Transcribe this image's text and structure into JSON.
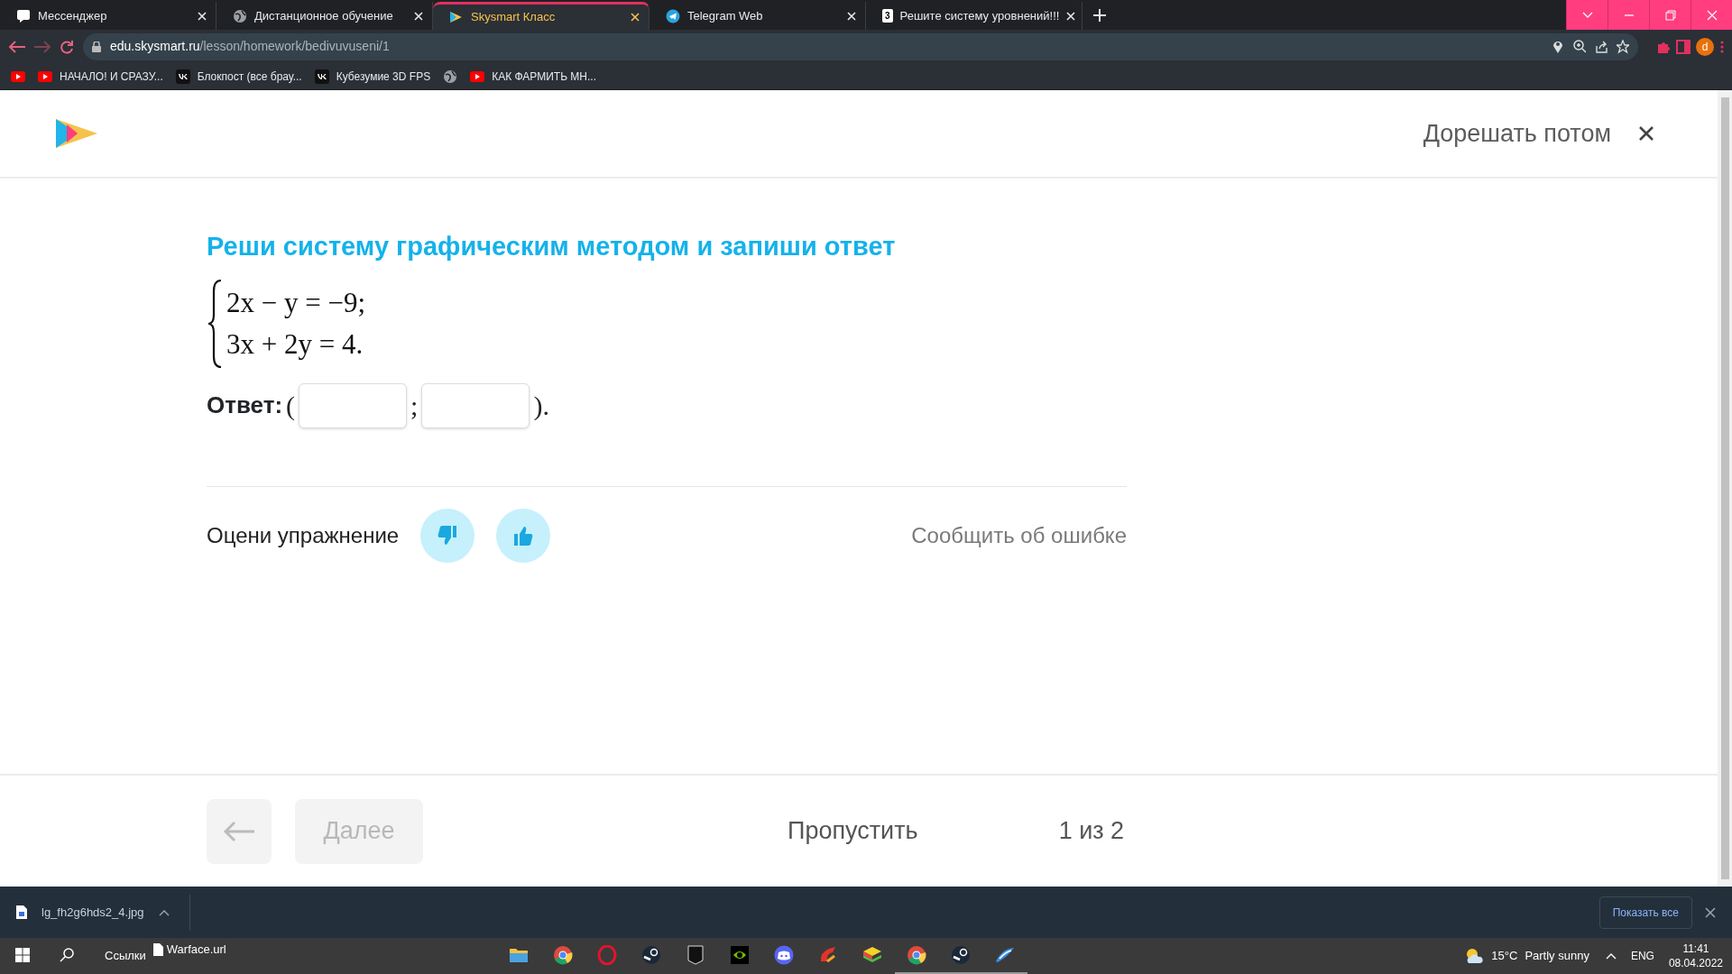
{
  "browser": {
    "tabs": [
      {
        "title": "Мессенджер",
        "kind": "chat",
        "selected": false
      },
      {
        "title": "Дистанционное обучение",
        "kind": "globe",
        "selected": false
      },
      {
        "title": "Skysmart Класс",
        "kind": "skysmart",
        "selected": true
      },
      {
        "title": "Telegram Web",
        "kind": "telegram",
        "selected": false
      },
      {
        "title": "Решите систему уровнений!!!",
        "kind": "badge",
        "badge": "3",
        "selected": false
      }
    ],
    "address": {
      "host": "edu.skysmart.ru",
      "path": "/lesson/homework/bedivuvuseni/1"
    },
    "avatar": "d",
    "bookmarks": [
      {
        "kind": "youtube"
      },
      {
        "kind": "youtube",
        "label": "НАЧАЛО! И СРАЗУ..."
      },
      {
        "kind": "vk",
        "label": "Блокпост (все брау..."
      },
      {
        "kind": "vk",
        "label": "Кубезумие 3D FPS"
      },
      {
        "kind": "globe"
      },
      {
        "kind": "youtube",
        "label": "КАК ФАРМИТЬ МН..."
      }
    ]
  },
  "page": {
    "finish_later": "Дорешать потом",
    "title": "Реши систему графическим методом и запиши ответ",
    "equations": [
      "2x − y = −9;",
      "3x + 2y = 4."
    ],
    "answer": {
      "label": "Ответ:",
      "open": "(",
      "separator": ";",
      "close": ")."
    },
    "rating_label": "Оцени упражнение",
    "report": "Сообщить об ошибке",
    "footer": {
      "next": "Далее",
      "next_disabled": true,
      "skip": "Пропустить",
      "progress": "1 из 2"
    }
  },
  "downloads": {
    "file": "lg_fh2g6hds2_4.jpg",
    "show_all": "Показать все"
  },
  "taskbar": {
    "links": "Ссылки",
    "shortcut": "Warface.url",
    "apps": [
      {
        "kind": "folder",
        "running": false
      },
      {
        "kind": "chrome",
        "running": false
      },
      {
        "kind": "opera",
        "running": false
      },
      {
        "kind": "steam",
        "running": false
      },
      {
        "kind": "epic",
        "running": false
      },
      {
        "kind": "nvidia",
        "running": false
      },
      {
        "kind": "discord",
        "running": false
      },
      {
        "kind": "ccleaner",
        "running": false
      },
      {
        "kind": "bluestacks",
        "running": false
      },
      {
        "kind": "chrome",
        "running": true
      },
      {
        "kind": "steam",
        "running": true
      },
      {
        "kind": "warface",
        "running": true
      }
    ],
    "temperature": "15°C",
    "weather": "Partly sunny",
    "language": "ENG",
    "time": "11:41",
    "date": "08.04.2022"
  }
}
